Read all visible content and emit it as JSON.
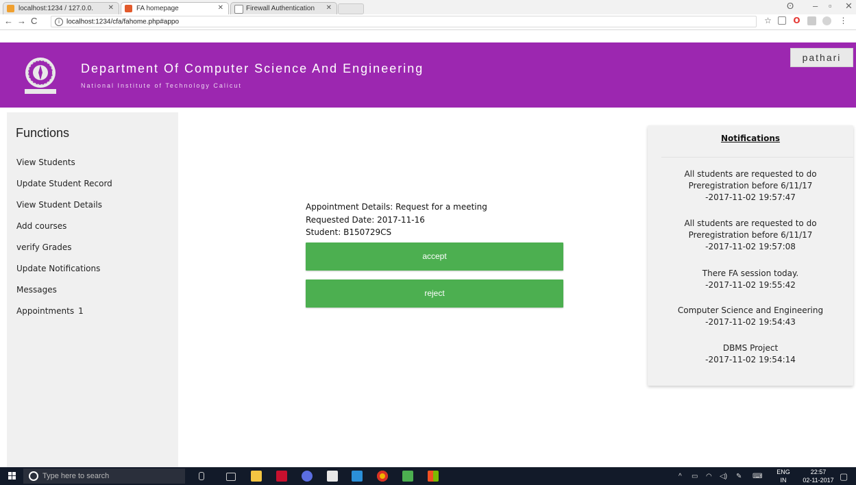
{
  "browser": {
    "tabs": [
      {
        "label": "localhost:1234 / 127.0.0."
      },
      {
        "label": "FA homepage"
      },
      {
        "label": "Firewall Authentication"
      }
    ],
    "url": "localhost:1234/cfa/fahome.php#appo"
  },
  "header": {
    "title": "Department Of Computer Science And Engineering",
    "subtitle": "National Institute of Technology Calicut",
    "user": "pathari",
    "color": "#9c27b0"
  },
  "sidebar": {
    "title": "Functions",
    "items": [
      {
        "label": "View Students"
      },
      {
        "label": "Update Student Record"
      },
      {
        "label": "View Student Details"
      },
      {
        "label": "Add courses"
      },
      {
        "label": "verify Grades"
      },
      {
        "label": "Update Notifications"
      },
      {
        "label": "Messages"
      },
      {
        "label": "Appointments",
        "count": "1"
      }
    ]
  },
  "appointment": {
    "details": "Appointment Details: Request for a meeting",
    "date": "Requested Date: 2017-11-16",
    "student": "Student: B150729CS",
    "accept_label": "accept",
    "reject_label": "reject",
    "button_color": "#4caf50"
  },
  "notifications": {
    "title": "Notifications",
    "items": [
      {
        "lines": [
          "All students are requested to do",
          "Preregistration before 6/11/17",
          "-2017-11-02 19:57:47"
        ]
      },
      {
        "lines": [
          "All students are requested to do",
          "Preregistration before 6/11/17",
          "-2017-11-02 19:57:08"
        ]
      },
      {
        "lines": [
          "There FA session today.",
          "-2017-11-02 19:55:42"
        ]
      },
      {
        "lines": [
          "Computer Science and Engineering",
          "-2017-11-02 19:54:43"
        ]
      },
      {
        "lines": [
          "DBMS Project",
          "-2017-11-02 19:54:14"
        ]
      }
    ]
  },
  "taskbar": {
    "search_placeholder": "Type here to search",
    "lang": "ENG",
    "region": "IN",
    "time": "22:57",
    "date": "02-11-2017"
  }
}
